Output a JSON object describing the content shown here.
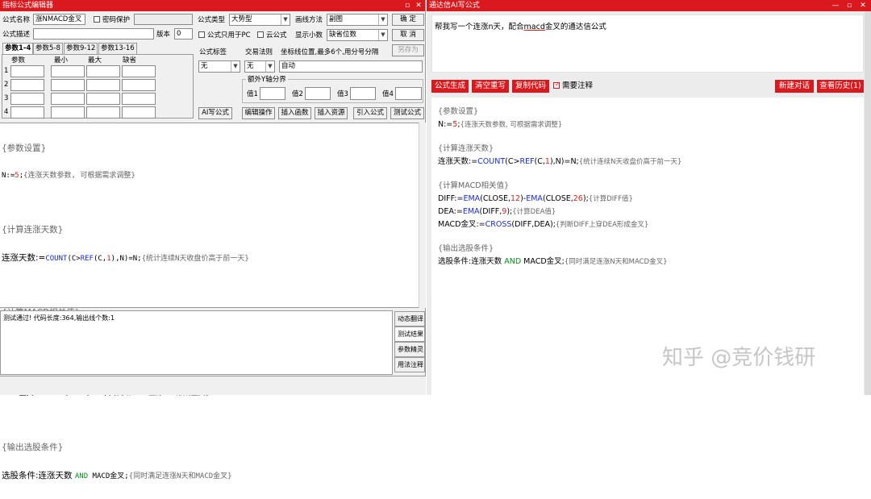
{
  "left_window": {
    "title": "指标公式编辑器",
    "title_buttons": [
      "▫",
      "✕"
    ],
    "name_label": "公式名称",
    "name_value": "涨NMACD金叉",
    "password_label": "密码保护",
    "desc_label": "公式描述",
    "version_label": "版本",
    "version_value": "0",
    "type_label": "公式类型",
    "type_value": "大势型",
    "draw_label": "画线方法",
    "draw_value": "副图",
    "ok_button": "确  定",
    "cancel_button": "取  消",
    "save_as_button": "另存为",
    "pc_only_label": "公式只用于PC",
    "cloud_label": "云公式",
    "decimal_label": "显示小数",
    "decimal_value": "缺省位数",
    "tabs": [
      "参数1-4",
      "参数5-8",
      "参数9-12",
      "参数13-16"
    ],
    "param_headers": [
      "参数",
      "最小",
      "最大",
      "缺省"
    ],
    "param_rows": [
      "1",
      "2",
      "3",
      "4"
    ],
    "formula_tag_label": "公式标签",
    "trade_rule_label": "交易法则",
    "coord_label": "坐标线位置,最多6个,用分号分隔",
    "tag_value": "无",
    "rule_value": "无",
    "coord_value": "自动",
    "yaxis_label": "额外Y轴分界",
    "y_labels": [
      "值1",
      "值2",
      "值3",
      "值4"
    ],
    "tool_buttons": [
      "AI写公式",
      "编辑操作",
      "插入函数",
      "插入资源",
      "引入公式",
      "测试公式"
    ],
    "status_text": "测试通过! 代码长度:364,输出线个数:1",
    "side_buttons": [
      "动态翻译",
      "测试结果",
      "参数精灵",
      "用法注释"
    ]
  },
  "code": {
    "l1_comment": "{参数设置}",
    "l2_var": "N:=",
    "l2_num": "5",
    "l2_semi": ";",
    "l2_comment": "{连涨天数参数, 可根据需求调整}",
    "l4_comment": "{计算连涨天数}",
    "l5_var": "连涨天数:=",
    "l5_fn": "COUNT",
    "l5_a": "(C>",
    "l5_fn2": "REF",
    "l5_b": "(C,",
    "l5_num": "1",
    "l5_c": "),N)=N;",
    "l5_comment": "{统计连续N天收盘价高于前一天}",
    "l7_comment": "{计算MACD相关值}",
    "l8_var": "DIFF:=",
    "l8_fn1": "EMA",
    "l8_a": "(CLOSE,",
    "l8_num1": "12",
    "l8_b": ")-",
    "l8_fn2": "EMA",
    "l8_c": "(CLOSE,",
    "l8_num2": "26",
    "l8_d": ");",
    "l8_comment": "{计算DIFF值}",
    "l9_var": "DEA:=",
    "l9_fn": "EMA",
    "l9_a": "(DIFF,",
    "l9_num": "9",
    "l9_b": ");",
    "l9_comment": "{计算DEA值}",
    "l10_var": "MACD金叉:=",
    "l10_fn": "CROSS",
    "l10_a": "(DIFF,DEA);",
    "l10_comment": "{判断DIFF上穿DEA形成金叉}",
    "l12_comment": "{输出选股条件}",
    "l13_var": "选股条件:连涨天数 ",
    "l13_and": "AND",
    "l13_b": " MACD金叉;",
    "l13_comment": "{同时满足连涨N天和MACD金叉}"
  },
  "right_window": {
    "title": "通达信AI写公式",
    "title_buttons": [
      "—",
      "▫",
      "✕"
    ],
    "prompt_text_a": "帮我写一个连涨n天，配合",
    "prompt_text_link": "macd",
    "prompt_text_b": "金叉的通达信公式",
    "buttons": [
      "公式生成",
      "清空重写",
      "复制代码"
    ],
    "annotate_label": "需要注释",
    "new_chat_button": "新建对话",
    "history_button": "查看历史(1)",
    "watermark": "知乎 @竞价钱研",
    "colors": {
      "accent": "#d9191d",
      "function": "#1a2bd6",
      "number": "#d62222",
      "keyword": "#0a8a1a"
    }
  }
}
